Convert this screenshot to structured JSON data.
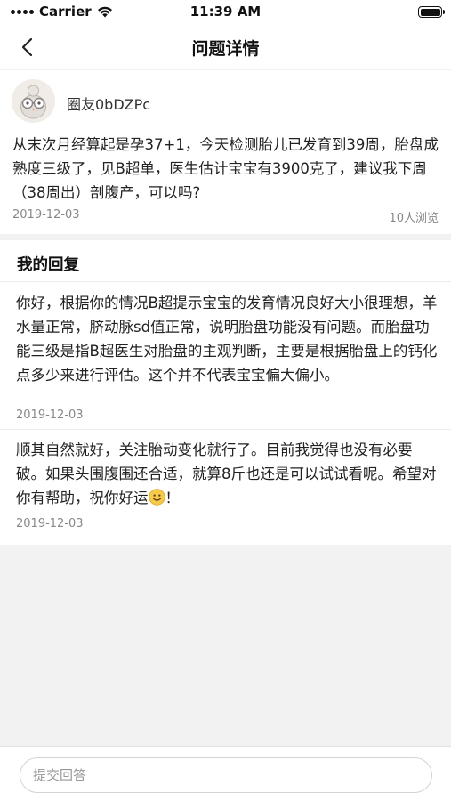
{
  "status_bar": {
    "carrier": "Carrier",
    "time": "11:39 AM"
  },
  "nav": {
    "title": "问题详情",
    "back_icon": "chevron-left-icon"
  },
  "question": {
    "username": "圈友0bDZPc",
    "avatar_icon": "owl-avatar",
    "text": "从末次月经算起是孕37+1，今天检测胎儿已发育到39周，胎盘成熟度三级了，见B超单，医生估计宝宝有3900克了，建议我下周（38周出）剖腹产，可以吗?",
    "date": "2019-12-03",
    "views": "10人浏览"
  },
  "replies_section": {
    "title": "我的回复",
    "items": [
      {
        "text": "你好，根据你的情况B超提示宝宝的发育情况良好大小很理想，羊水量正常，脐动脉sd值正常，说明胎盘功能没有问题。而胎盘功能三级是指B超医生对胎盘的主观判断，主要是根据胎盘上的钙化点多少来进行评估。这个并不代表宝宝偏大偏小。",
        "date": "2019-12-03"
      },
      {
        "text": "顺其自然就好，关注胎动变化就行了。目前我觉得也没有必要破。如果头围腹围还合适，就算8斤也还是可以试试看呢。希望对你有帮助，祝你好运",
        "text_suffix": "！",
        "emoji_icon": "smiley-emoji",
        "date": "2019-12-03"
      }
    ]
  },
  "bottom_bar": {
    "input_placeholder": "提交回答",
    "input_value": ""
  },
  "colors": {
    "background": "#f2f2f2",
    "card": "#ffffff",
    "text_primary": "#222222",
    "text_secondary": "#888888",
    "divider": "#ececec"
  }
}
